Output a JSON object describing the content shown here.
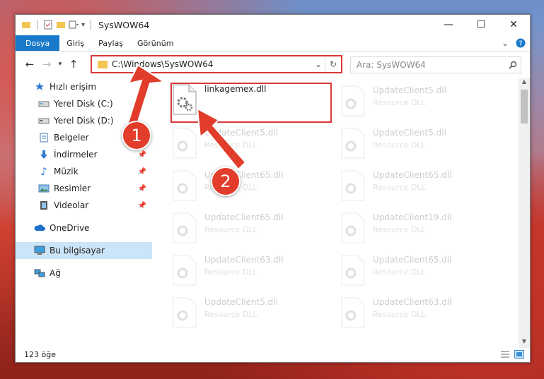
{
  "window": {
    "title": "SysWOW64"
  },
  "ribbon": {
    "tabs": [
      "Dosya",
      "Giriş",
      "Paylaş",
      "Görünüm"
    ]
  },
  "address": {
    "path": "C:\\Windows\\SysWOW64"
  },
  "search": {
    "placeholder": "Ara: SysWOW64"
  },
  "sidebar": {
    "items": [
      {
        "label": "Hızlı erişim",
        "icon": "star-icon"
      },
      {
        "label": "Yerel Disk (C:)",
        "icon": "drive-icon"
      },
      {
        "label": "Yerel Disk (D:)",
        "icon": "drive-icon"
      },
      {
        "label": "Belgeler",
        "icon": "documents-icon"
      },
      {
        "label": "İndirmeler",
        "icon": "download-icon"
      },
      {
        "label": "Müzik",
        "icon": "music-icon"
      },
      {
        "label": "Resimler",
        "icon": "pictures-icon"
      },
      {
        "label": "Videolar",
        "icon": "video-icon"
      },
      {
        "label": "OneDrive",
        "icon": "cloud-icon"
      },
      {
        "label": "Bu bilgisayar",
        "icon": "computer-icon"
      },
      {
        "label": "Ağ",
        "icon": "network-icon"
      }
    ]
  },
  "files": {
    "highlighted": {
      "name": "linkagemex.dll",
      "desc": ""
    },
    "left": [
      {
        "name": "UpdateClient5.dll",
        "desc": "Resource DLL"
      },
      {
        "name": "UpdateClient65.dll",
        "desc": "Resource DLL"
      },
      {
        "name": "UpdateClient65.dll",
        "desc": "Resource DLL"
      },
      {
        "name": "UpdateClient63.dll",
        "desc": "Resource DLL"
      },
      {
        "name": "UpdateClient5.dll",
        "desc": "Resource DLL"
      }
    ],
    "right": [
      {
        "name": "UpdateClient5.dll",
        "desc": "Resource DLL"
      },
      {
        "name": "UpdateClient5.dll",
        "desc": "Resource DLL"
      },
      {
        "name": "UpdateClient65.dll",
        "desc": "Resource DLL"
      },
      {
        "name": "UpdateClient19.dll",
        "desc": "Resource DLL"
      },
      {
        "name": "UpdateClient65.dll",
        "desc": "Resource DLL"
      },
      {
        "name": "UpdateClient63.dll",
        "desc": "Resource DLL"
      }
    ]
  },
  "status": {
    "count": "123 öğe"
  },
  "callouts": {
    "one": "1",
    "two": "2"
  },
  "colors": {
    "accent": "#1979ca",
    "highlight": "#d9393a",
    "badge": "#e23c2a"
  }
}
